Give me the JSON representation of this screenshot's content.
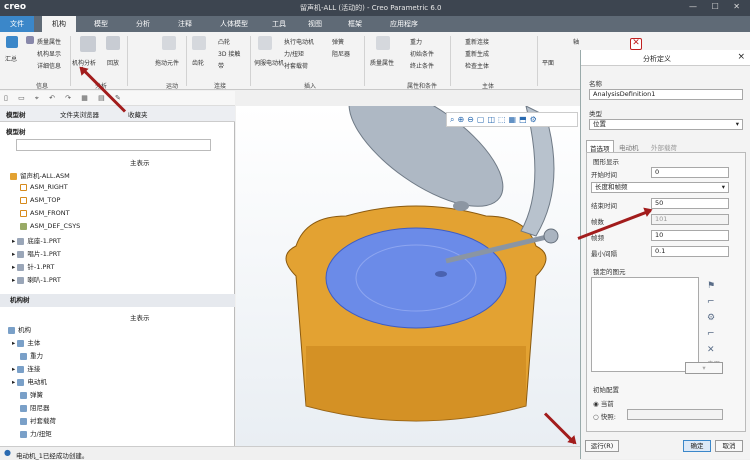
{
  "app": {
    "logo": "creo",
    "title": "留声机-ALL (活动的) - Creo Parametric 6.0"
  },
  "tabs": [
    "文件",
    "机构",
    "模型",
    "分析",
    "注释",
    "人体模型",
    "工具",
    "视图",
    "框架",
    "应用程序"
  ],
  "ribbon": {
    "groups": [
      "信息",
      "分析",
      "运动",
      "连接",
      "插入",
      "属性和条件",
      "主体"
    ],
    "items": {
      "summary": "汇总",
      "mass": "质量属性",
      "mech_display": "机构显示",
      "detail": "详细信息",
      "mech_analysis": "机构分析",
      "replay": "回放",
      "drag": "拖动元件",
      "gear": "齿轮",
      "cam": "凸轮",
      "cam3d": "3D 接触",
      "belt": "带",
      "servo": "伺服电动机",
      "exec_motor": "执行电动机",
      "force": "力/扭矩",
      "spring": "弹簧",
      "damper": "阻尼器",
      "bushing": "衬套载荷",
      "mass_prop": "质量属性",
      "gravity": "重力",
      "init": "初始条件",
      "stop": "终止条件",
      "redefine": "重新连接",
      "regen": "重新生成",
      "check": "检查主体",
      "global": "全局",
      "plane": "平面",
      "axis": "轴",
      "close": "关闭"
    }
  },
  "panel": {
    "tabs": [
      "模型树",
      "文件夹浏览器",
      "收藏夹"
    ],
    "model_tree_title": "模型树",
    "main_rep": "主表示",
    "tree": [
      "留声机-ALL.ASM",
      "ASM_RIGHT",
      "ASM_TOP",
      "ASM_FRONT",
      "ASM_DEF_CSYS",
      "底座-1.PRT",
      "唱片-1.PRT",
      "针-1.PRT",
      "喇叭-1.PRT"
    ],
    "mech_tree_title": "机构树",
    "mech_main_rep": "主表示",
    "mech": [
      "机构",
      "主体",
      "重力",
      "连接",
      "电动机",
      "弹簧",
      "阻尼器",
      "衬套载荷",
      "力/扭矩"
    ]
  },
  "status": "电动机_1已经成功创建。",
  "dialog": {
    "title": "分析定义",
    "name_label": "名称",
    "name_value": "AnalysisDefinition1",
    "type_label": "类型",
    "type_value": "位置",
    "tabs": [
      "首选项",
      "电动机",
      "外部载荷"
    ],
    "graph_label": "图形显示",
    "start_label": "开始时间",
    "start_value": "0",
    "mode_value": "长度和帧频",
    "end_label": "结束时间",
    "end_value": "50",
    "frames_label": "帧数",
    "frames_value": "101",
    "rate_label": "帧频",
    "rate_value": "10",
    "min_label": "最小间隔",
    "min_value": "0.1",
    "locked_label": "锁定的图元",
    "enable_label": "启用",
    "init_label": "初始配置",
    "current_label": "当前",
    "snapshot_label": "快照:",
    "run": "运行(R)",
    "ok": "确定",
    "cancel": "取消"
  },
  "colors": {
    "accent": "#3b87c9",
    "ribbon_tab_bg": "#5f6a76",
    "arrow": "#a21c1c",
    "platter": "#6b8be8",
    "base": "#e3a232"
  }
}
